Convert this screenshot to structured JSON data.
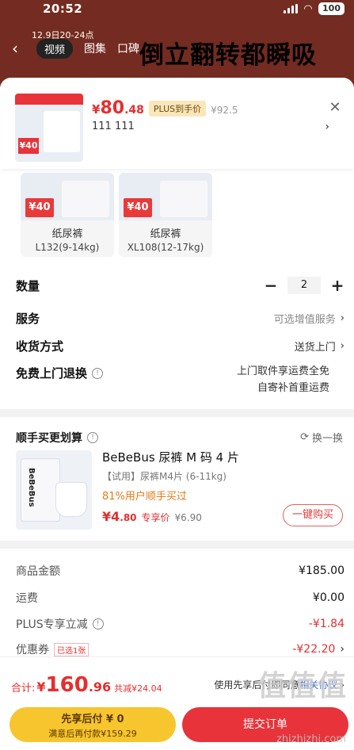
{
  "status_bar": {
    "time": "20:52",
    "battery": "100"
  },
  "background": {
    "date_text": "12.9日20-24点",
    "tabs": [
      "视频",
      "图集",
      "口碑"
    ],
    "headline": "倒立翻转都瞬吸"
  },
  "header": {
    "price_symbol": "¥",
    "price_int": "80",
    "price_dec": ".48",
    "plus_badge": "PLUS到手价",
    "price_old": "¥92.5",
    "selection": "111  111",
    "thumb_price": "¥40"
  },
  "sizes": [
    {
      "name": "纸尿裤",
      "spec": "L132(9-14kg)",
      "tag": "¥40"
    },
    {
      "name": "纸尿裤",
      "spec": "XL108(12-17kg)",
      "tag": "¥40"
    }
  ],
  "rows": {
    "quantity_label": "数量",
    "quantity_value": "2",
    "service_label": "服务",
    "service_value": "可选增值服务",
    "delivery_label": "收货方式",
    "delivery_value": "送货上门",
    "return_label": "免费上门退换",
    "return_line1": "上门取件享运费全免",
    "return_line2": "自寄补首重运费"
  },
  "combo": {
    "title": "顺手买更划算",
    "swap": "换一换",
    "brand": "BeBeBus",
    "name": "BeBeBus 尿裤 M 码 4 片",
    "spec": "【试用】尿裤M4片 (6-11kg)",
    "rate": "81%用户顺手买过",
    "price_int": "¥4",
    "price_dec": ".80",
    "price_tag": "专享价",
    "price_old": "¥6.90",
    "buy_label": "一键购买"
  },
  "summary": [
    {
      "label": "商品金额",
      "value": "¥185.00",
      "red": false
    },
    {
      "label": "运费",
      "value": "¥0.00",
      "red": false
    },
    {
      "label": "PLUS专享立减",
      "value": "-¥1.84",
      "red": true
    },
    {
      "label": "优惠券",
      "value": "-¥22.20",
      "red": true,
      "tag": "已选1张"
    }
  ],
  "footer": {
    "total_label": "合计:",
    "total_sym": "¥",
    "total_int": "160",
    "total_dec": ".96",
    "total_save": "共减¥24.04",
    "agree_text": "使用先享后付即同意",
    "agree_link": "相关协议",
    "pay_later_1": "先享后付 ¥ 0",
    "pay_later_2": "满意后再付款¥159.29",
    "submit": "提交订单",
    "watermark": "值值值",
    "watermark_url": "zhizhizhi.com"
  },
  "colors": {
    "accent": "#e62e2e",
    "plus": "#fbe6b9",
    "pay_later": "#f7c52d",
    "submit": "#e8333a"
  }
}
